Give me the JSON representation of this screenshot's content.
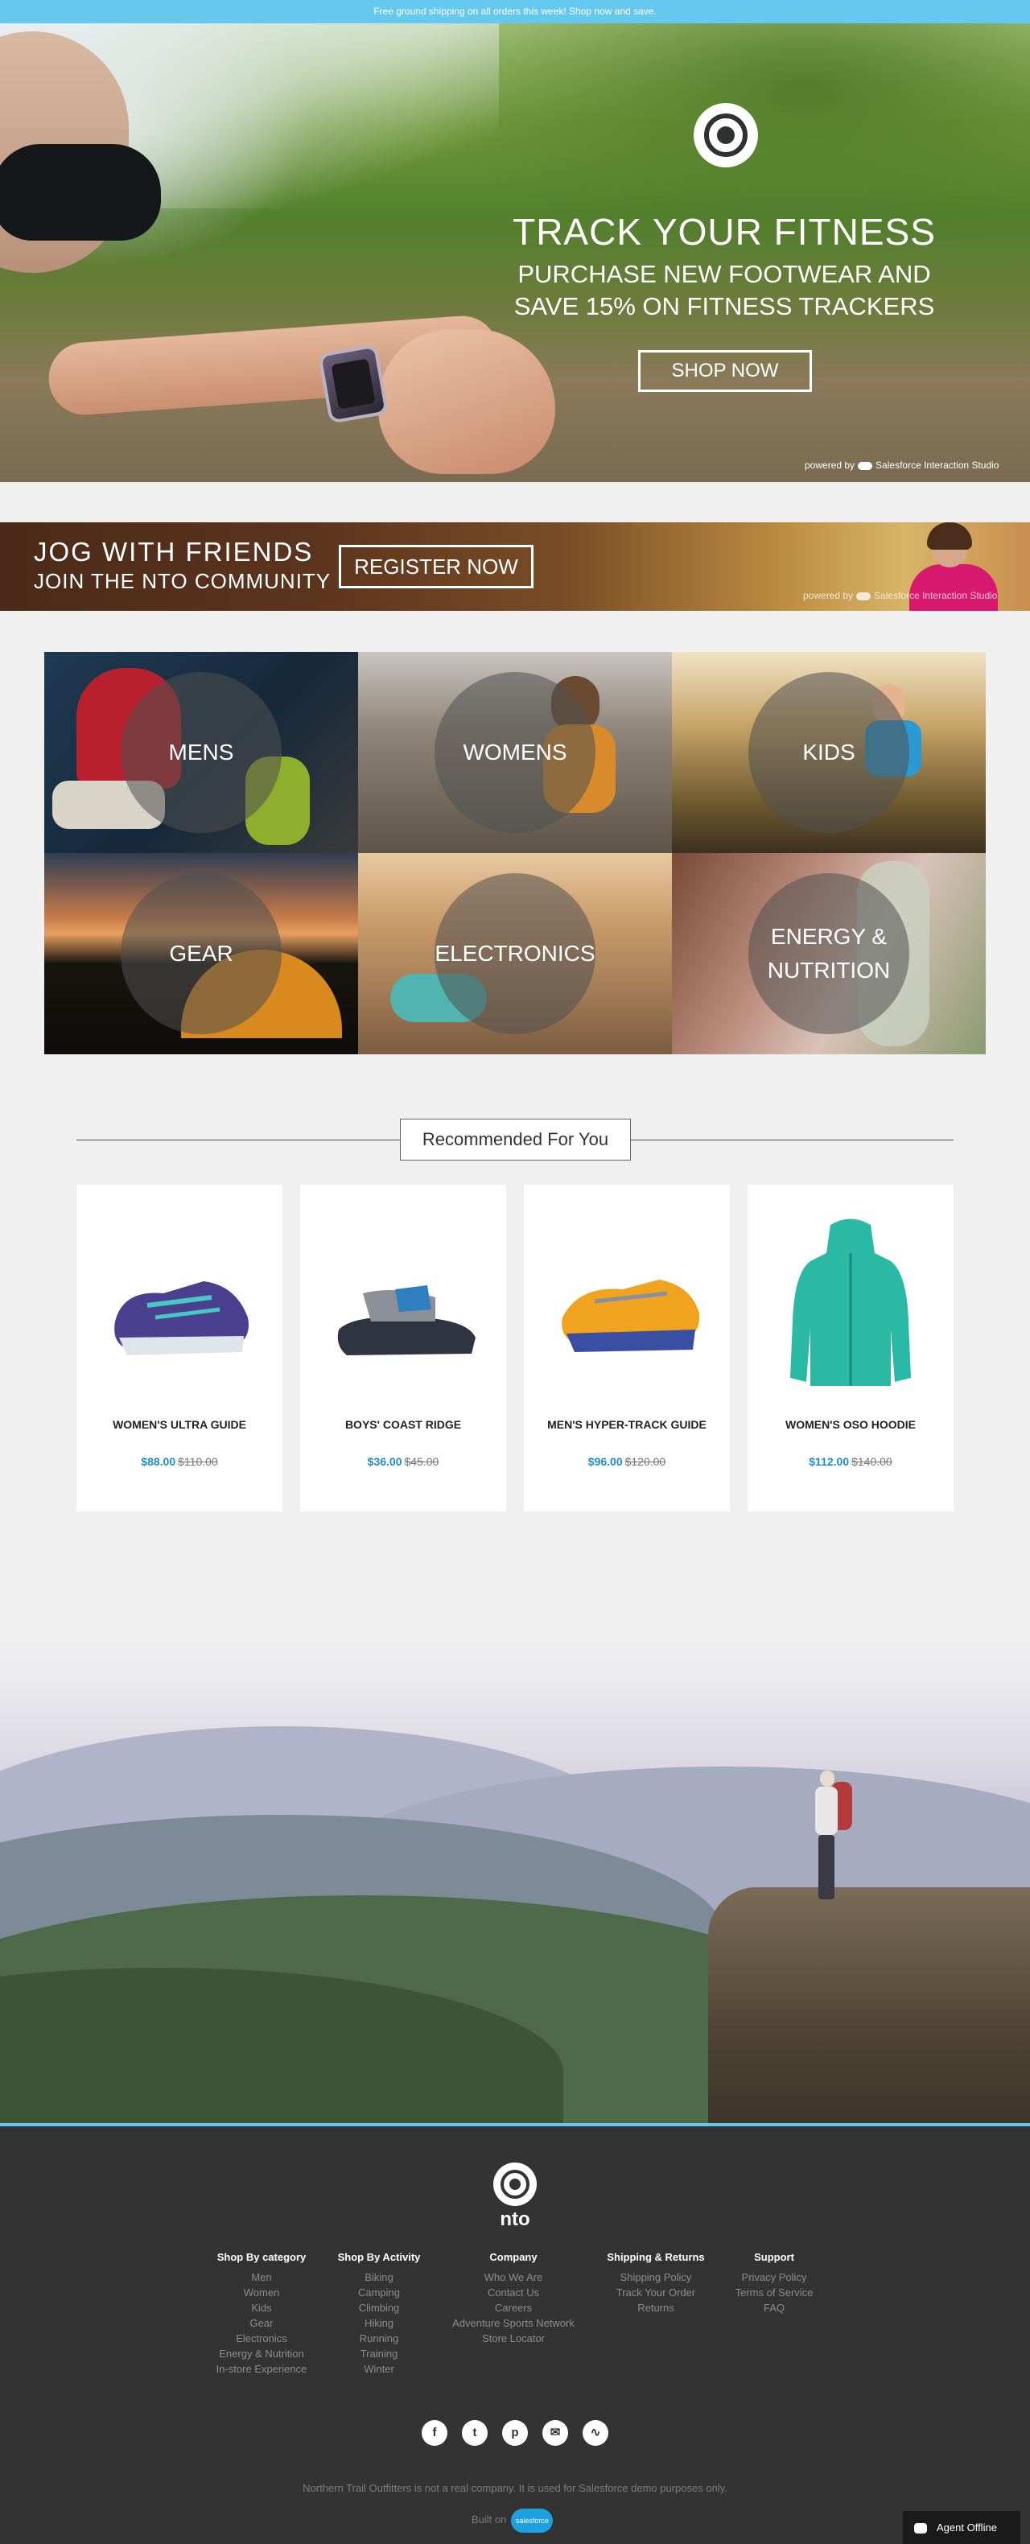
{
  "announcement": "Free ground shipping on all orders this week! Shop now and save.",
  "hero": {
    "title": "TRACK YOUR FITNESS",
    "subtitle_line1": "PURCHASE NEW FOOTWEAR AND",
    "subtitle_line2": "SAVE 15% ON FITNESS TRACKERS",
    "button": "SHOP NOW",
    "powered_prefix": "powered by",
    "powered_brand": "Salesforce Interaction Studio"
  },
  "jog": {
    "title": "JOG WITH FRIENDS",
    "subtitle": "JOIN THE NTO COMMUNITY",
    "button": "REGISTER NOW",
    "powered_prefix": "powered by",
    "powered_brand": "Salesforce Interaction Studio"
  },
  "categories": [
    "MENS",
    "WOMENS",
    "KIDS",
    "GEAR",
    "ELECTRONICS",
    "ENERGY &",
    "NUTRITION"
  ],
  "recommended": {
    "title": "Recommended For You",
    "products": [
      {
        "name": "WOMEN'S ULTRA GUIDE",
        "price": "$88.00",
        "old_price": "$110.00"
      },
      {
        "name": "BOYS' COAST RIDGE",
        "price": "$36.00",
        "old_price": "$45.00"
      },
      {
        "name": "MEN'S HYPER-TRACK GUIDE",
        "price": "$96.00",
        "old_price": "$120.00"
      },
      {
        "name": "WOMEN'S OSO HOODIE",
        "price": "$112.00",
        "old_price": "$140.00"
      }
    ]
  },
  "footer": {
    "brand": "nto",
    "columns": [
      {
        "heading": "Shop By category",
        "items": [
          "Men",
          "Women",
          "Kids",
          "Gear",
          "Electronics",
          "Energy & Nutrition",
          "In-store Experience"
        ]
      },
      {
        "heading": "Shop By Activity",
        "items": [
          "Biking",
          "Camping",
          "Climbing",
          "Hiking",
          "Running",
          "Training",
          "Winter"
        ]
      },
      {
        "heading": "Company",
        "items": [
          "Who We Are",
          "Contact Us",
          "Careers",
          "Adventure Sports Network",
          "Store Locator"
        ]
      },
      {
        "heading": "Shipping & Returns",
        "items": [
          "Shipping Policy",
          "Track Your Order",
          "Returns"
        ]
      },
      {
        "heading": "Support",
        "items": [
          "Privacy Policy",
          "Terms of Service",
          "FAQ"
        ]
      }
    ],
    "social_icons": [
      "facebook-icon",
      "twitter-icon",
      "pinterest-icon",
      "email-icon",
      "activity-icon"
    ],
    "note": "Northern Trail Outfitters is not a real company. It is used for Salesforce demo purposes only.",
    "built_on": "Built on",
    "built_on_brand": "salesforce"
  },
  "agent": {
    "label": "Agent Offline"
  },
  "colors": {
    "accent": "#65c9ef",
    "price": "#1d8cc7",
    "footer_bg": "#333333"
  }
}
